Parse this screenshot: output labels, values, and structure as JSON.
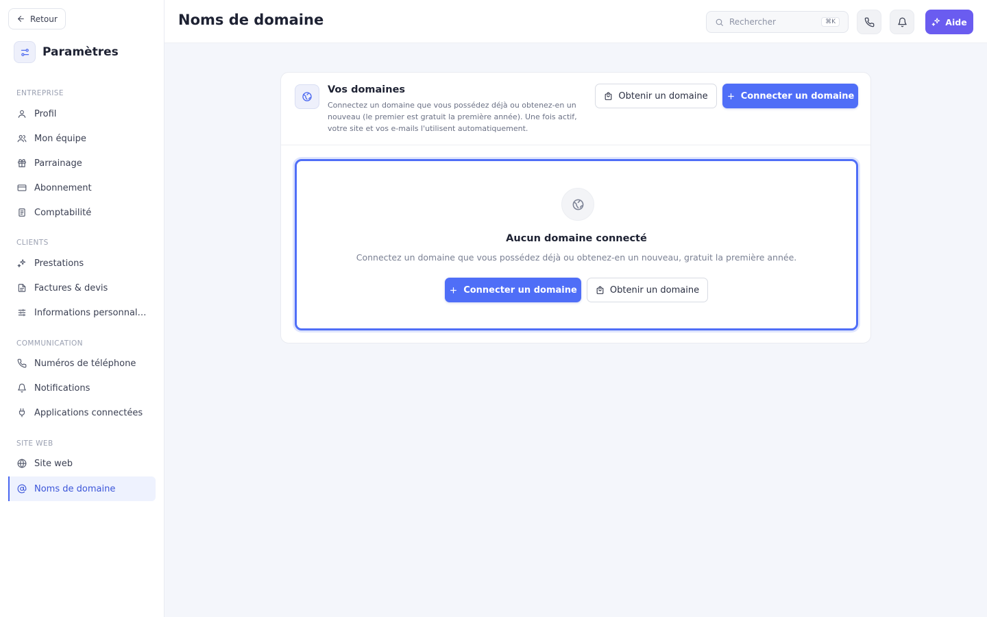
{
  "sidebar": {
    "back_label": "Retour",
    "title": "Paramètres",
    "sections": [
      {
        "label": "ENTREPRISE",
        "items": [
          {
            "label": "Profil",
            "icon": "user-icon"
          },
          {
            "label": "Mon équipe",
            "icon": "users-icon"
          },
          {
            "label": "Parrainage",
            "icon": "gift-icon"
          },
          {
            "label": "Abonnement",
            "icon": "credit-card-icon"
          },
          {
            "label": "Comptabilité",
            "icon": "ledger-icon"
          }
        ]
      },
      {
        "label": "CLIENTS",
        "items": [
          {
            "label": "Prestations",
            "icon": "sparkles-icon"
          },
          {
            "label": "Factures & devis",
            "icon": "file-icon"
          },
          {
            "label": "Informations personnalisées",
            "icon": "sliders-icon"
          }
        ]
      },
      {
        "label": "COMMUNICATION",
        "items": [
          {
            "label": "Numéros de téléphone",
            "icon": "phone-icon"
          },
          {
            "label": "Notifications",
            "icon": "bell-icon"
          },
          {
            "label": "Applications connectées",
            "icon": "plug-icon"
          }
        ]
      },
      {
        "label": "SITE WEB",
        "items": [
          {
            "label": "Site web",
            "icon": "globe-icon"
          },
          {
            "label": "Noms de domaine",
            "icon": "at-icon",
            "active": true
          }
        ]
      }
    ]
  },
  "header": {
    "title": "Noms de domaine",
    "search_placeholder": "Rechercher",
    "search_shortcut": "⌘K",
    "help_label": "Aide"
  },
  "domains": {
    "title": "Vos domaines",
    "description": "Connectez un domaine que vous possédez déjà ou obtenez-en un nouveau (le premier est gratuit la première année). Une fois actif, votre site et vos e-mails l'utilisent automatiquement.",
    "get_domain_label": "Obtenir un domaine",
    "connect_domain_label": "Connecter un domaine",
    "empty": {
      "title": "Aucun domaine connecté",
      "description": "Connectez un domaine que vous possédez déjà ou obtenez-en un nouveau, gratuit la première année.",
      "connect_label": "Connecter un domaine",
      "get_label": "Obtenir un domaine"
    }
  },
  "colors": {
    "accent": "#4f6ef7",
    "help": "#6a5cf0",
    "active_nav_bg": "#eef2fe"
  }
}
